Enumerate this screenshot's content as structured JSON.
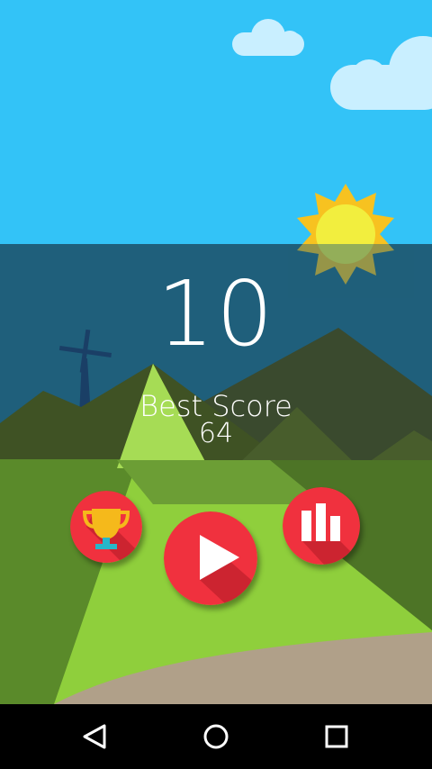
{
  "game": {
    "score": "10",
    "best_score_label": "Best Score",
    "best_score_value": "64"
  },
  "buttons": {
    "achievements": "trophy-icon",
    "play": "play-icon",
    "leaderboard": "leaderboard-bars-icon"
  },
  "navigation": {
    "back": "back-triangle-icon",
    "home": "home-circle-icon",
    "recents": "recents-square-icon"
  },
  "colors": {
    "sky": "#33c3f7",
    "sea": "#1f5f7b",
    "button_red": "#f0313e",
    "sun": "#f7e034"
  }
}
